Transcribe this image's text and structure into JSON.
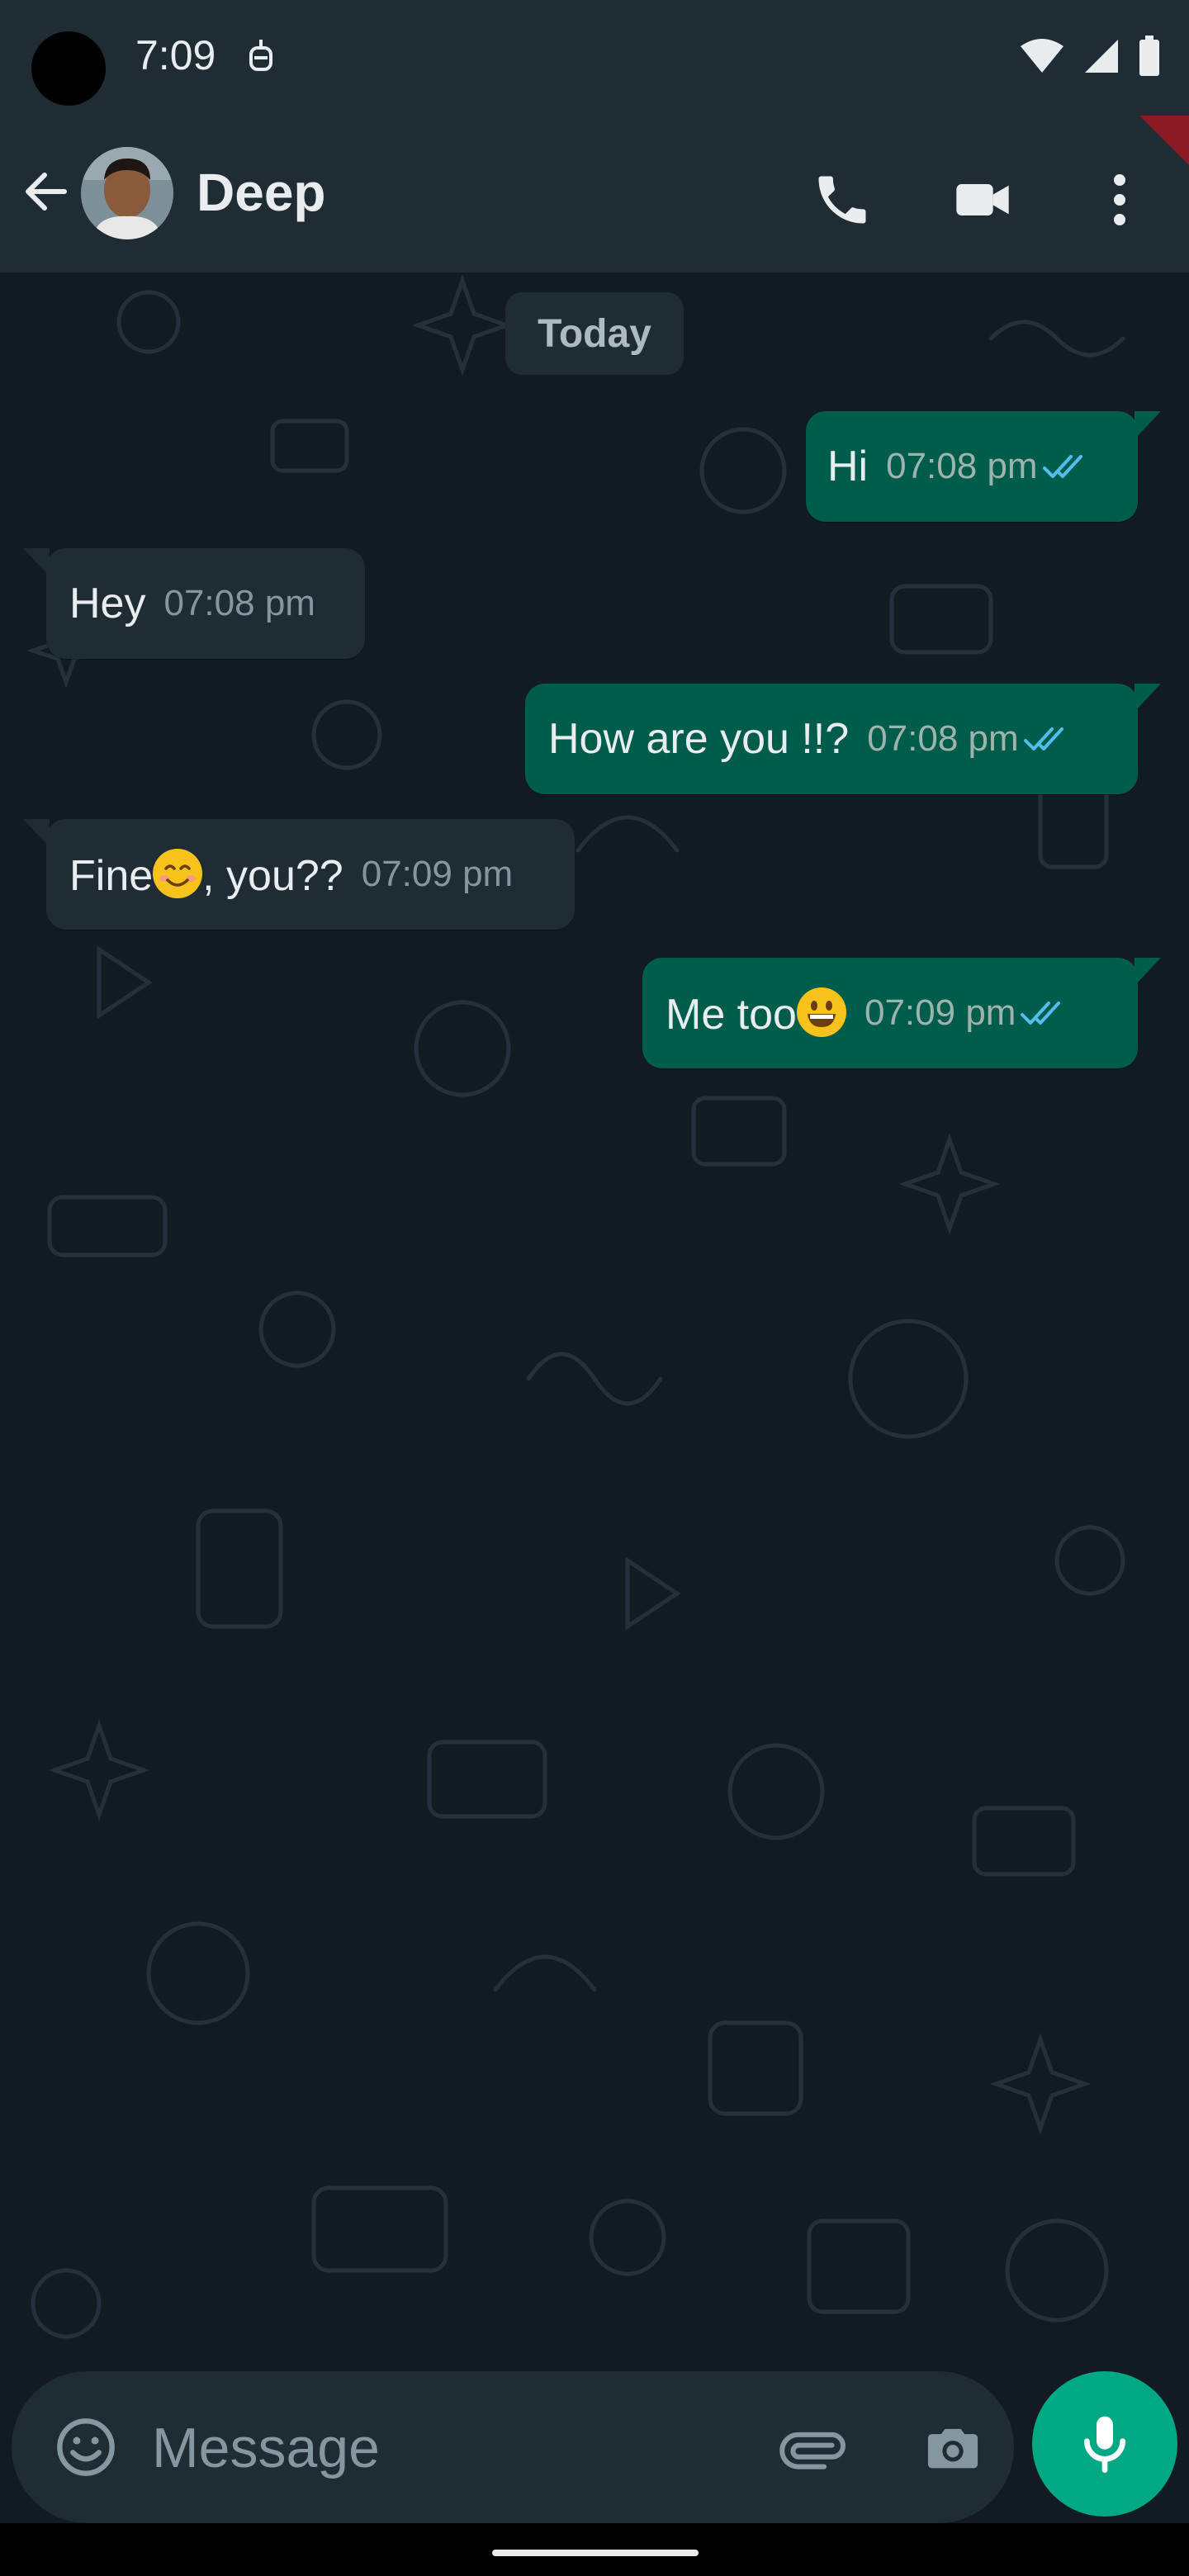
{
  "status_bar": {
    "time": "7:09"
  },
  "contact": {
    "name": "Deep"
  },
  "chat": {
    "date_label": "Today",
    "messages": [
      {
        "direction": "out",
        "text": "Hi",
        "time": "07:08 pm",
        "read": true
      },
      {
        "direction": "in",
        "text": "Hey",
        "time": "07:08 pm"
      },
      {
        "direction": "out",
        "text": "How are you !!?",
        "time": "07:08 pm",
        "read": true
      },
      {
        "direction": "in",
        "text_before": "Fine",
        "emoji": "smiling-face",
        "text_after": ", you??",
        "time": "07:09 pm"
      },
      {
        "direction": "out",
        "text": "Me too",
        "emoji": "grinning-face",
        "time": "07:09 pm",
        "read": true
      }
    ]
  },
  "composer": {
    "placeholder": "Message"
  },
  "colors": {
    "header": "#1f2c34",
    "background": "#111b21",
    "outgoing_bubble": "#005c4b",
    "incoming_bubble": "#1f2c34",
    "read_ticks": "#53bdeb",
    "accent": "#00a884"
  },
  "icons": [
    "back-arrow-icon",
    "phone-icon",
    "video-camera-icon",
    "more-vertical-icon",
    "emoji-icon",
    "paperclip-icon",
    "camera-icon",
    "microphone-icon",
    "double-check-icon"
  ]
}
